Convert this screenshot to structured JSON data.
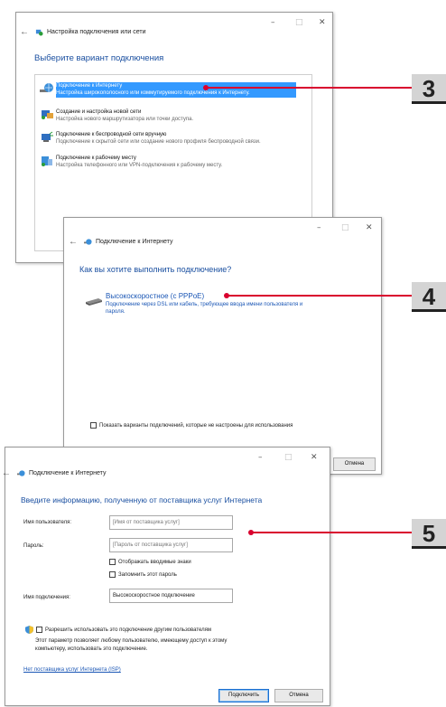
{
  "window_controls": {
    "minimize": "–",
    "maximize": "□",
    "close": "✕"
  },
  "win1": {
    "title": "Настройка подключения или сети",
    "heading": "Выберите вариант подключения",
    "options": [
      {
        "title": "Подключение к Интернету",
        "subtitle": "Настройка широкополосного или коммутируемого подключения к Интернету.",
        "selected": true,
        "icon": "globe-icon"
      },
      {
        "title": "Создание и настройка новой сети",
        "subtitle": "Настройка нового маршрутизатора или точки доступа.",
        "selected": false,
        "icon": "router-icon"
      },
      {
        "title": "Подключение к беспроводной сети вручную",
        "subtitle": "Подключение к скрытой сети или создание нового профиля беспроводной связи.",
        "selected": false,
        "icon": "wireless-icon"
      },
      {
        "title": "Подключение к рабочему месту",
        "subtitle": "Настройка телефонного или VPN-подключения к рабочему месту.",
        "selected": false,
        "icon": "workplace-icon"
      }
    ]
  },
  "win2": {
    "title": "Подключение к Интернету",
    "heading": "Как вы хотите выполнить подключение?",
    "option_title": "Высокоскоростное (с PPPoE)",
    "option_subtitle_1": "Подключение через DSL или кабель, требующее ввода имени пользователя и",
    "option_subtitle_2": "пароля.",
    "show_options_label": "Показать варианты подключений, которые не настроены для использования",
    "cancel_label": "Отмена"
  },
  "win3": {
    "title": "Подключение к Интернету",
    "heading": "Введите информацию, полученную от поставщика услуг Интернета",
    "username_label": "Имя пользователя:",
    "username_placeholder": "[Имя от поставщика услуг]",
    "password_label": "Пароль:",
    "password_placeholder": "[Пароль от поставщика услуг]",
    "show_chars_label": "Отображать вводимые знаки",
    "remember_label": "Запомнить этот пароль",
    "connection_name_label": "Имя подключения:",
    "connection_name_value": "Высокоскоростное подключение",
    "allow_others_label": "Разрешить использовать это подключение другим пользователям",
    "allow_desc_1": "Этот параметр позволяет любому пользователю, имеющему доступ к этому",
    "allow_desc_2": "компьютеру, использовать это подключение.",
    "no_isp_link": "Нет поставщика услуг Интернета (ISP)",
    "connect_label": "Подключить",
    "cancel_label": "Отмена"
  },
  "callouts": {
    "step3": "3",
    "step4": "4",
    "step5": "5"
  },
  "colors": {
    "accent": "#1a4fa0",
    "selection": "#3399ff",
    "callout": "#d9002e",
    "badge": "#d4d4d4"
  }
}
